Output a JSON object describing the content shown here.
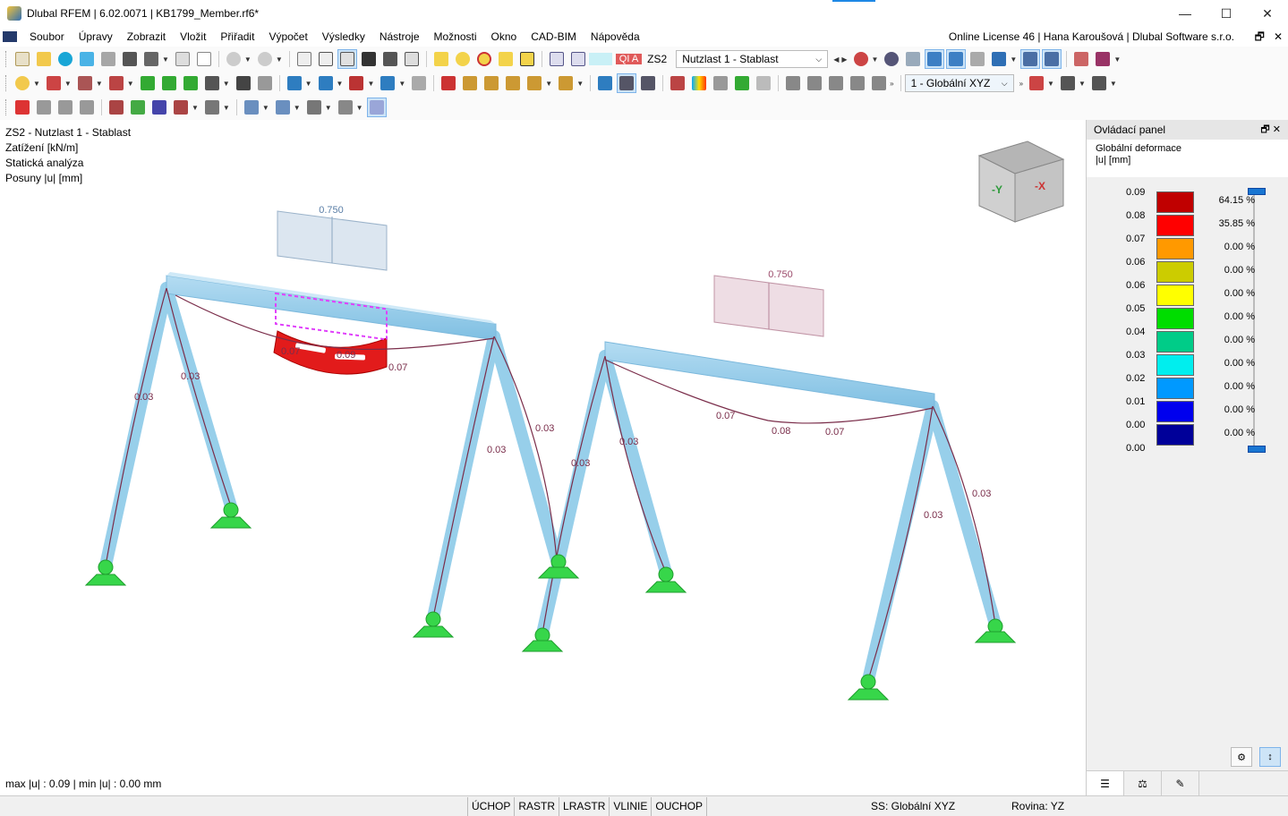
{
  "window": {
    "title": "Dlubal RFEM | 6.02.0071 | KB1799_Member.rf6*",
    "controls": {
      "minimize": "—",
      "maximize": "☐",
      "close": "✕"
    }
  },
  "menu": {
    "items": [
      "Soubor",
      "Úpravy",
      "Zobrazit",
      "Vložit",
      "Přiřadit",
      "Výpočet",
      "Výsledky",
      "Nástroje",
      "Možnosti",
      "Okno",
      "CAD-BIM",
      "Nápověda"
    ],
    "license": "Online License 46 | Hana Karoušová | Dlubal Software s.r.o.",
    "mdi_restore": "🗗",
    "mdi_close": "✕"
  },
  "toolbar": {
    "load_case_badge": "QI A",
    "load_case_id": "ZS2",
    "load_case_name": "Nutzlast 1 - Stablast",
    "coord_system": "1 - Globální XYZ"
  },
  "viewport": {
    "info_lines": [
      "ZS2 - Nutzlast 1 - Stablast",
      "Zatížení [kN/m]",
      "Statická analýza",
      "Posuny |u| [mm]"
    ],
    "max_min": "max |u| : 0.09 | min |u| : 0.00 mm",
    "view_cube": {
      "left_face": "-Y",
      "right_face": "-X"
    },
    "load_labels": [
      "0.750",
      "0.750"
    ],
    "deformation_labels": {
      "frame1_beam": [
        "0.07",
        "0.09",
        "0.07"
      ],
      "frame1_columns": [
        "0.03",
        "0.03",
        "0.03",
        "0.03"
      ],
      "frame2_beam": [
        "0.07",
        "0.08",
        "0.07"
      ],
      "frame2_columns": [
        "0.03",
        "0.03",
        "0.03",
        "0.03"
      ]
    }
  },
  "panel": {
    "title": "Ovládací panel",
    "subtitle": "Globální deformace",
    "unit": "|u| [mm]",
    "legend": [
      {
        "value": "0.09",
        "color": "#c00000",
        "percent": "64.15 %"
      },
      {
        "value": "0.08",
        "color": "#ff0000",
        "percent": "35.85 %"
      },
      {
        "value": "0.07",
        "color": "#ff9900",
        "percent": "0.00 %"
      },
      {
        "value": "0.06",
        "color": "#cccc00",
        "percent": "0.00 %"
      },
      {
        "value": "0.06",
        "color": "#ffff00",
        "percent": "0.00 %"
      },
      {
        "value": "0.05",
        "color": "#00dd00",
        "percent": "0.00 %"
      },
      {
        "value": "0.04",
        "color": "#00cc88",
        "percent": "0.00 %"
      },
      {
        "value": "0.03",
        "color": "#00eeee",
        "percent": "0.00 %"
      },
      {
        "value": "0.02",
        "color": "#0099ff",
        "percent": "0.00 %"
      },
      {
        "value": "0.01",
        "color": "#0000ee",
        "percent": "0.00 %"
      },
      {
        "value": "0.00",
        "color": "#000099",
        "percent": "0.00 %"
      }
    ],
    "legend_last_value": "0.00"
  },
  "status": {
    "buttons": [
      "ÚCHOP",
      "RASTR",
      "LRASTR",
      "VLINIE",
      "OUCHOP"
    ],
    "coord_system": "SS: Globální XYZ",
    "plane": "Rovina: YZ"
  },
  "colors": {
    "member": "#8fcbe9",
    "support": "#37d64a",
    "deform_line": "#7a2d4a",
    "load_blue": "#d6e2ee",
    "load_pink": "#ecd8e0"
  }
}
